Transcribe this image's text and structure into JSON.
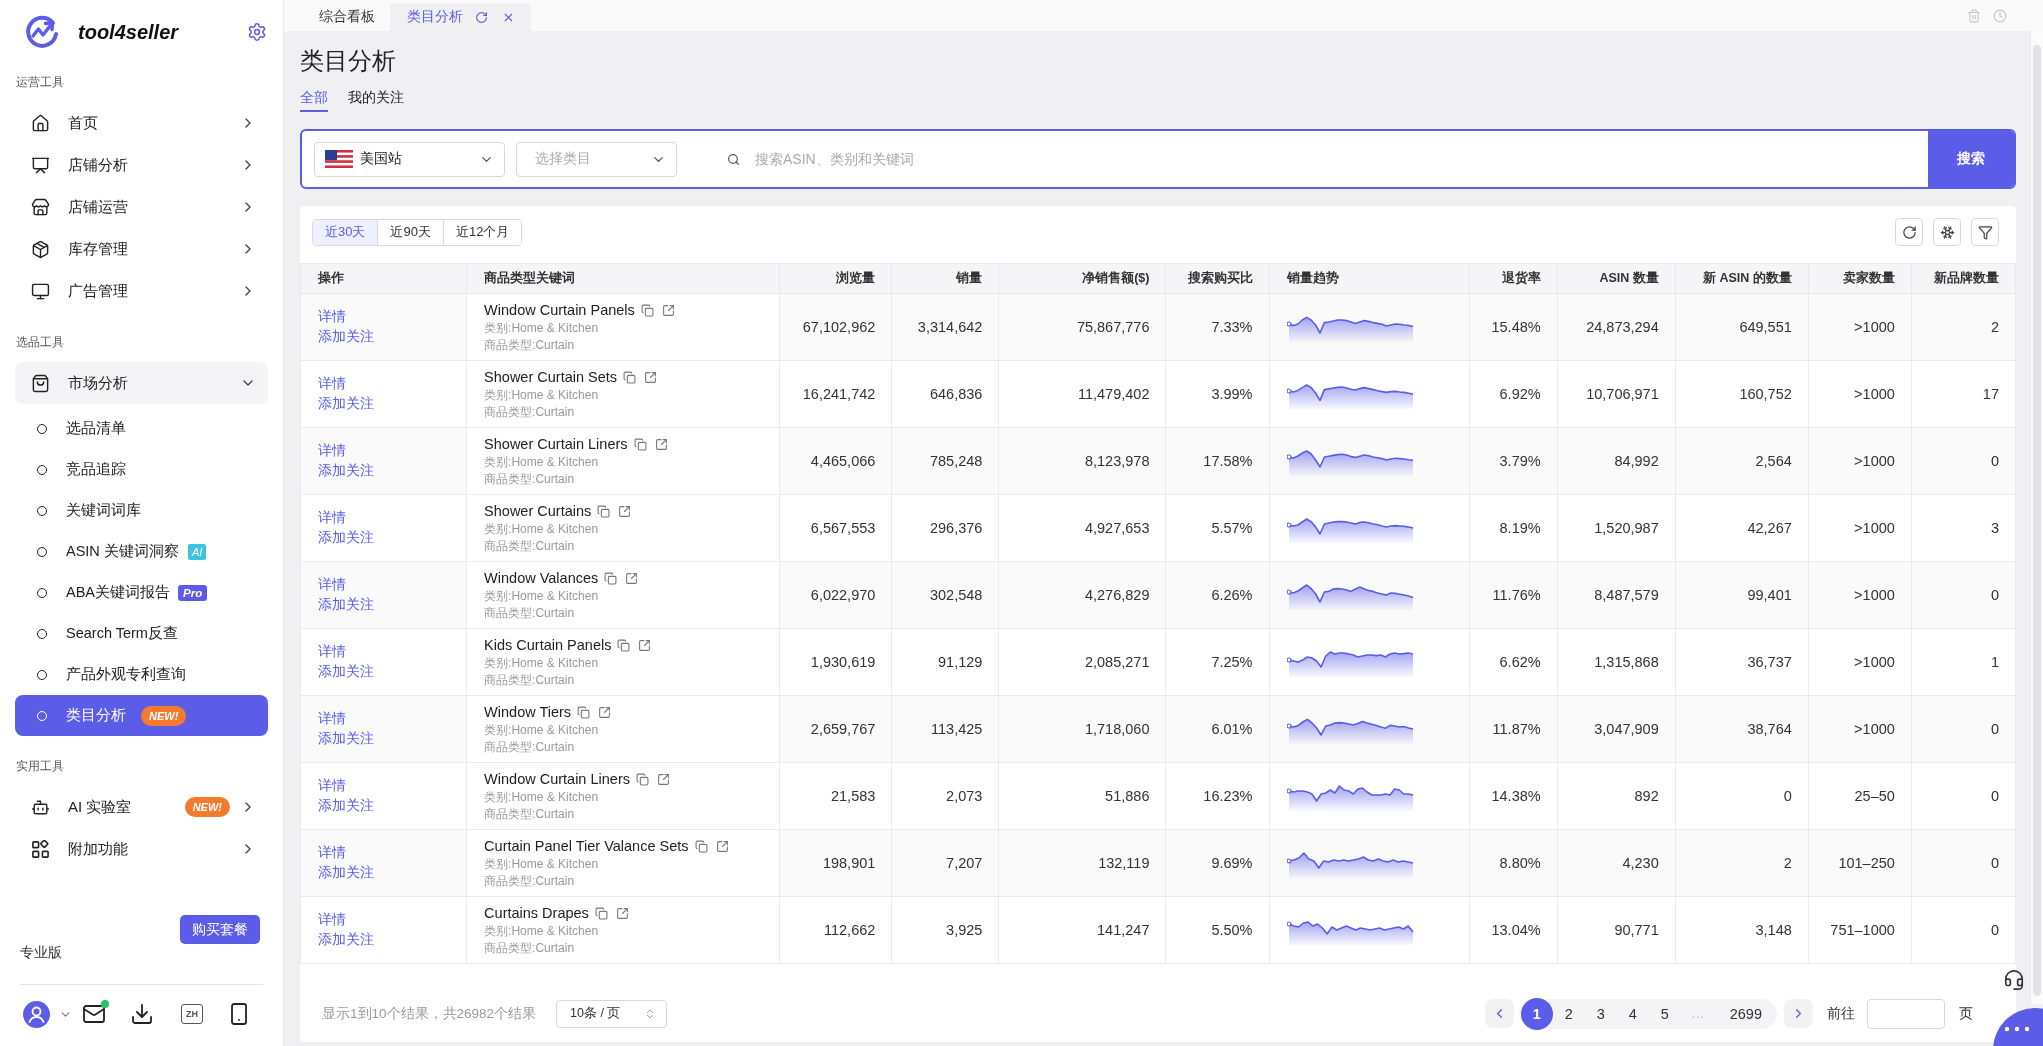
{
  "tabs": [
    {
      "label": "综合看板",
      "selected": false
    },
    {
      "label": "类目分析",
      "selected": true
    }
  ],
  "sidebar": {
    "logo": "tool4seller",
    "sections": [
      {
        "label": "运营工具",
        "items": [
          {
            "label": "首页",
            "expanded": false
          },
          {
            "label": "店铺分析",
            "expanded": false
          },
          {
            "label": "店铺运营",
            "expanded": false
          },
          {
            "label": "库存管理",
            "expanded": false
          },
          {
            "label": "广告管理",
            "expanded": false
          }
        ]
      },
      {
        "label": "选品工具",
        "items": [
          {
            "label": "市场分析",
            "expanded": true,
            "children": [
              {
                "label": "选品清单",
                "selected": false
              },
              {
                "label": "竞品追踪",
                "selected": false
              },
              {
                "label": "关键词词库",
                "selected": false
              },
              {
                "label": "ASIN 关键词洞察",
                "selected": false,
                "badge": {
                  "kind": "ai",
                  "text": "AI"
                }
              },
              {
                "label": "ABA关键词报告",
                "selected": false,
                "badge": {
                  "kind": "pro",
                  "text": "Pro"
                }
              },
              {
                "label": "Search Term反查",
                "selected": false
              },
              {
                "label": "产品外观专利查询",
                "selected": false
              },
              {
                "label": "类目分析",
                "selected": true,
                "badge": {
                  "kind": "new",
                  "text": "NEW!"
                }
              }
            ]
          }
        ]
      },
      {
        "label": "实用工具",
        "items": [
          {
            "label": "AI 实验室",
            "expanded": false,
            "badge": {
              "kind": "new",
              "text": "NEW!"
            }
          },
          {
            "label": "附加功能",
            "expanded": false
          }
        ]
      }
    ],
    "plan": {
      "button": "购买套餐",
      "name": "专业版"
    },
    "footer": {
      "mail_unread": true,
      "language": "ZH"
    }
  },
  "page": {
    "title": "类目分析",
    "tabs": [
      {
        "label": "全部",
        "selected": true
      },
      {
        "label": "我的关注",
        "selected": false
      }
    ]
  },
  "search": {
    "site": "美国站",
    "category": {
      "placeholder": "选择类目"
    },
    "query": {
      "placeholder": "搜索ASIN、类别和关键词"
    },
    "button": "搜索"
  },
  "periods": [
    {
      "label": "近30天",
      "selected": true
    },
    {
      "label": "近90天",
      "selected": false
    },
    {
      "label": "近12个月",
      "selected": false
    }
  ],
  "table": {
    "columns": [
      "操作",
      "商品类型关键词",
      "浏览量",
      "销量",
      "净销售额($)",
      "搜索购买比",
      "销量趋势",
      "退货率",
      "ASIN 数量",
      "新 ASIN 的数量",
      "卖家数量",
      "新品牌数量"
    ],
    "rows": [
      {
        "actions": [
          "详情",
          "添加关注"
        ],
        "keyword": "Window Curtain Panels",
        "category": "类别:Home & Kitchen",
        "product_type": "商品类型:Curtain",
        "views": "67,102,962",
        "sales": "3,314,642",
        "net_sales": "75,867,776",
        "search_purchase_ratio": "7.33%",
        "return_rate": "15.48%",
        "asin_count": "24,873,294",
        "new_asin_count": "649,551",
        "seller_count": ">1000",
        "new_brand_count": "2"
      },
      {
        "actions": [
          "详情",
          "添加关注"
        ],
        "keyword": "Shower Curtain Sets",
        "category": "类别:Home & Kitchen",
        "product_type": "商品类型:Curtain",
        "views": "16,241,742",
        "sales": "646,836",
        "net_sales": "11,479,402",
        "search_purchase_ratio": "3.99%",
        "return_rate": "6.92%",
        "asin_count": "10,706,971",
        "new_asin_count": "160,752",
        "seller_count": ">1000",
        "new_brand_count": "17"
      },
      {
        "actions": [
          "详情",
          "添加关注"
        ],
        "keyword": "Shower Curtain Liners",
        "category": "类别:Home & Kitchen",
        "product_type": "商品类型:Curtain",
        "views": "4,465,066",
        "sales": "785,248",
        "net_sales": "8,123,978",
        "search_purchase_ratio": "17.58%",
        "return_rate": "3.79%",
        "asin_count": "84,992",
        "new_asin_count": "2,564",
        "seller_count": ">1000",
        "new_brand_count": "0"
      },
      {
        "actions": [
          "详情",
          "添加关注"
        ],
        "keyword": "Shower Curtains",
        "category": "类别:Home & Kitchen",
        "product_type": "商品类型:Curtain",
        "views": "6,567,553",
        "sales": "296,376",
        "net_sales": "4,927,653",
        "search_purchase_ratio": "5.57%",
        "return_rate": "8.19%",
        "asin_count": "1,520,987",
        "new_asin_count": "42,267",
        "seller_count": ">1000",
        "new_brand_count": "3"
      },
      {
        "actions": [
          "详情",
          "添加关注"
        ],
        "keyword": "Window Valances",
        "category": "类别:Home & Kitchen",
        "product_type": "商品类型:Curtain",
        "views": "6,022,970",
        "sales": "302,548",
        "net_sales": "4,276,829",
        "search_purchase_ratio": "6.26%",
        "return_rate": "11.76%",
        "asin_count": "8,487,579",
        "new_asin_count": "99,401",
        "seller_count": ">1000",
        "new_brand_count": "0"
      },
      {
        "actions": [
          "详情",
          "添加关注"
        ],
        "keyword": "Kids Curtain Panels",
        "category": "类别:Home & Kitchen",
        "product_type": "商品类型:Curtain",
        "views": "1,930,619",
        "sales": "91,129",
        "net_sales": "2,085,271",
        "search_purchase_ratio": "7.25%",
        "return_rate": "6.62%",
        "asin_count": "1,315,868",
        "new_asin_count": "36,737",
        "seller_count": ">1000",
        "new_brand_count": "1"
      },
      {
        "actions": [
          "详情",
          "添加关注"
        ],
        "keyword": "Window Tiers",
        "category": "类别:Home & Kitchen",
        "product_type": "商品类型:Curtain",
        "views": "2,659,767",
        "sales": "113,425",
        "net_sales": "1,718,060",
        "search_purchase_ratio": "6.01%",
        "return_rate": "11.87%",
        "asin_count": "3,047,909",
        "new_asin_count": "38,764",
        "seller_count": ">1000",
        "new_brand_count": "0"
      },
      {
        "actions": [
          "详情",
          "添加关注"
        ],
        "keyword": "Window Curtain Liners",
        "category": "类别:Home & Kitchen",
        "product_type": "商品类型:Curtain",
        "views": "21,583",
        "sales": "2,073",
        "net_sales": "51,886",
        "search_purchase_ratio": "16.23%",
        "return_rate": "14.38%",
        "asin_count": "892",
        "new_asin_count": "0",
        "seller_count": "25–50",
        "new_brand_count": "0"
      },
      {
        "actions": [
          "详情",
          "添加关注"
        ],
        "keyword": "Curtain Panel Tier Valance Sets",
        "category": "类别:Home & Kitchen",
        "product_type": "商品类型:Curtain",
        "views": "198,901",
        "sales": "7,207",
        "net_sales": "132,119",
        "search_purchase_ratio": "9.69%",
        "return_rate": "8.80%",
        "asin_count": "4,230",
        "new_asin_count": "2",
        "seller_count": "101–250",
        "new_brand_count": "0"
      },
      {
        "actions": [
          "详情",
          "添加关注"
        ],
        "keyword": "Curtains Drapes",
        "category": "类别:Home & Kitchen",
        "product_type": "商品类型:Curtain",
        "views": "112,662",
        "sales": "3,925",
        "net_sales": "141,247",
        "search_purchase_ratio": "5.50%",
        "return_rate": "13.04%",
        "asin_count": "90,771",
        "new_asin_count": "3,148",
        "seller_count": "751–1000",
        "new_brand_count": "0"
      }
    ]
  },
  "pagination": {
    "summary": "显示1到10个结果，共26982个结果",
    "page_size": "10条 / 页",
    "pages": [
      {
        "kind": "page",
        "label": "1",
        "selected": true
      },
      {
        "kind": "page",
        "label": "2",
        "selected": false
      },
      {
        "kind": "page",
        "label": "3",
        "selected": false
      },
      {
        "kind": "page",
        "label": "4",
        "selected": false
      },
      {
        "kind": "page",
        "label": "5",
        "selected": false
      },
      {
        "kind": "ellipsis",
        "label": "…"
      },
      {
        "kind": "page",
        "label": "2699",
        "selected": false
      }
    ],
    "goto": {
      "label": "前往",
      "suffix": "页"
    }
  }
}
